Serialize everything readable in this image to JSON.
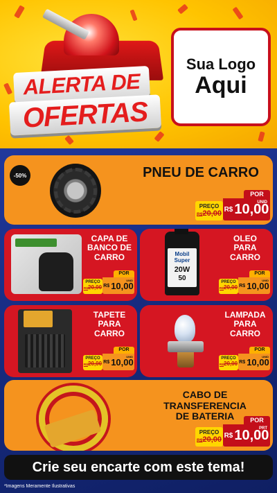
{
  "header": {
    "title_line1": "ALERTA DE",
    "title_line2": "OFERTAS",
    "logo_line1": "Sua Logo",
    "logo_line2": "Aqui"
  },
  "products": [
    {
      "id": "pneu",
      "name": "PNEU DE CARRO",
      "discount": "-50%",
      "preco_label": "PREÇO",
      "old_price": "R$20,00",
      "old_rs": "R$",
      "old_value": "20,00",
      "por_label": "POR",
      "currency": "R$",
      "price": "10,00",
      "unit": "UNID"
    },
    {
      "id": "capa",
      "name_lines": [
        "CAPA DE",
        "BANCO DE",
        "CARRO"
      ],
      "preco_label": "PREÇO",
      "old_rs": "R$",
      "old_value": "20,00",
      "por_label": "POR",
      "currency": "R$",
      "price": "10,00",
      "unit": "UNID"
    },
    {
      "id": "oleo",
      "name_lines": [
        "OLEO",
        "PARA",
        "CARRO"
      ],
      "preco_label": "PREÇO",
      "old_rs": "R$",
      "old_value": "20,00",
      "por_label": "POR",
      "currency": "R$",
      "price": "10,00",
      "unit": "UNID",
      "image_text": [
        "Mobil",
        "Super",
        "20W",
        "50"
      ]
    },
    {
      "id": "tapete",
      "name_lines": [
        "TAPETE",
        "PARA",
        "CARRO"
      ],
      "preco_label": "PREÇO",
      "old_rs": "R$",
      "old_value": "20,00",
      "por_label": "POR",
      "currency": "R$",
      "price": "10,00",
      "unit": "UNID"
    },
    {
      "id": "lampada",
      "name_lines": [
        "LAMPADA",
        "PARA",
        "CARRO"
      ],
      "preco_label": "PREÇO",
      "old_rs": "R$",
      "old_value": "20,00",
      "por_label": "POR",
      "currency": "R$",
      "price": "10,00",
      "unit": "UNID"
    },
    {
      "id": "cabo",
      "name_lines": [
        "CABO DE TRANSFERENCIA",
        "DE BATERIA"
      ],
      "preco_label": "PREÇO",
      "old_rs": "R$",
      "old_value": "20,00",
      "por_label": "POR",
      "currency": "R$",
      "price": "10,00",
      "unit": "PRT"
    }
  ],
  "banner": {
    "text": "Crie seu encarte com este tema!"
  },
  "disclaimer": "*Imagens Meramente Ilustrativas",
  "colors": {
    "header_yellow": "#ffc400",
    "brand_red": "#d51622",
    "card_orange": "#f5931e",
    "background_blue": "#1c2f8f",
    "price_yellow": "#ffd600"
  }
}
